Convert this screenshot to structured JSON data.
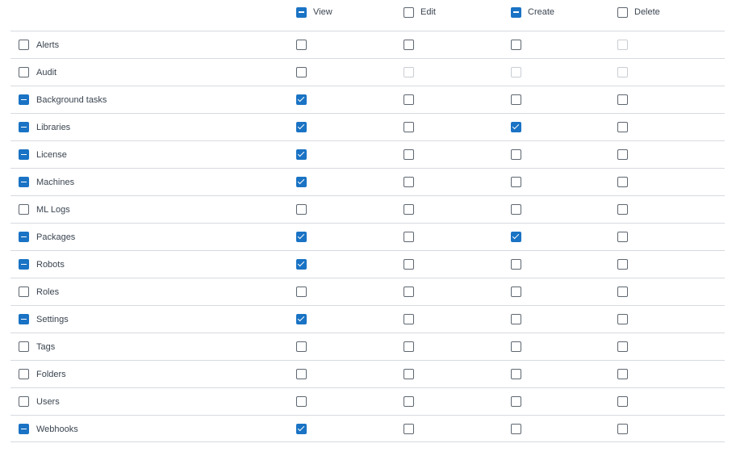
{
  "columns": [
    {
      "key": "view",
      "label": "View",
      "state": "indeterminate"
    },
    {
      "key": "edit",
      "label": "Edit",
      "state": "unchecked"
    },
    {
      "key": "create",
      "label": "Create",
      "state": "indeterminate"
    },
    {
      "key": "delete",
      "label": "Delete",
      "state": "unchecked"
    }
  ],
  "rows": [
    {
      "name": "Alerts",
      "row_state": "unchecked",
      "view": "unchecked",
      "edit": "unchecked",
      "create": "unchecked",
      "delete": "disabled"
    },
    {
      "name": "Audit",
      "row_state": "unchecked",
      "view": "unchecked",
      "edit": "disabled",
      "create": "disabled",
      "delete": "disabled"
    },
    {
      "name": "Background tasks",
      "row_state": "indeterminate",
      "view": "checked",
      "edit": "unchecked",
      "create": "unchecked",
      "delete": "unchecked"
    },
    {
      "name": "Libraries",
      "row_state": "indeterminate",
      "view": "checked",
      "edit": "unchecked",
      "create": "checked",
      "delete": "unchecked"
    },
    {
      "name": "License",
      "row_state": "indeterminate",
      "view": "checked",
      "edit": "unchecked",
      "create": "unchecked",
      "delete": "unchecked"
    },
    {
      "name": "Machines",
      "row_state": "indeterminate",
      "view": "checked",
      "edit": "unchecked",
      "create": "unchecked",
      "delete": "unchecked"
    },
    {
      "name": "ML Logs",
      "row_state": "unchecked",
      "view": "unchecked",
      "edit": "unchecked",
      "create": "unchecked",
      "delete": "unchecked"
    },
    {
      "name": "Packages",
      "row_state": "indeterminate",
      "view": "checked",
      "edit": "unchecked",
      "create": "checked",
      "delete": "unchecked"
    },
    {
      "name": "Robots",
      "row_state": "indeterminate",
      "view": "checked",
      "edit": "unchecked",
      "create": "unchecked",
      "delete": "unchecked"
    },
    {
      "name": "Roles",
      "row_state": "unchecked",
      "view": "unchecked",
      "edit": "unchecked",
      "create": "unchecked",
      "delete": "unchecked"
    },
    {
      "name": "Settings",
      "row_state": "indeterminate",
      "view": "checked",
      "edit": "unchecked",
      "create": "unchecked",
      "delete": "unchecked"
    },
    {
      "name": "Tags",
      "row_state": "unchecked",
      "view": "unchecked",
      "edit": "unchecked",
      "create": "unchecked",
      "delete": "unchecked"
    },
    {
      "name": "Folders",
      "row_state": "unchecked",
      "view": "unchecked",
      "edit": "unchecked",
      "create": "unchecked",
      "delete": "unchecked"
    },
    {
      "name": "Users",
      "row_state": "unchecked",
      "view": "unchecked",
      "edit": "unchecked",
      "create": "unchecked",
      "delete": "unchecked"
    },
    {
      "name": "Webhooks",
      "row_state": "indeterminate",
      "view": "checked",
      "edit": "unchecked",
      "create": "unchecked",
      "delete": "unchecked"
    }
  ],
  "colors": {
    "accent": "#1a73c4",
    "border": "#d6dadf",
    "checkbox_border": "#5e6670",
    "disabled_border": "#c9ced3",
    "text": "#3a4450"
  }
}
